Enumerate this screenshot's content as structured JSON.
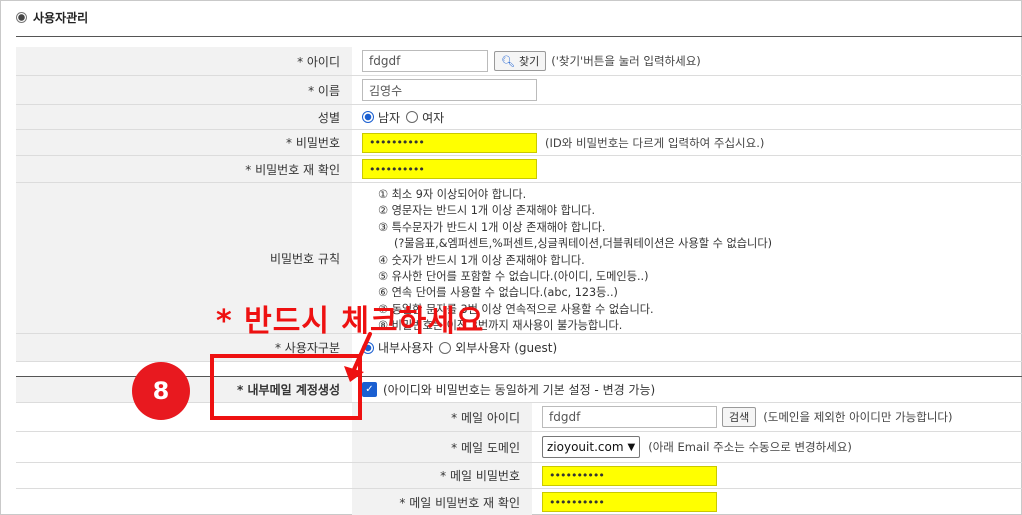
{
  "section_title": "사용자관리",
  "form": {
    "id": {
      "label": "* 아이디",
      "value": "fdgdf",
      "search_label": "찾기",
      "hint": "('찾기'버튼을 눌러 입력하세요)"
    },
    "name": {
      "label": "* 이름",
      "value": "김영수"
    },
    "gender": {
      "label": "성별",
      "option_male": "남자",
      "option_female": "여자",
      "selected": "남자"
    },
    "password": {
      "label": "* 비밀번호",
      "value": "••••••••••",
      "hint": "(ID와 비밀번호는 다르게 입력하여 주십시요.)"
    },
    "password_confirm": {
      "label": "* 비밀번호 재 확인",
      "value": "••••••••••"
    },
    "password_rules": {
      "label": "비밀번호 규칙",
      "lines": [
        "① 최소 9자 이상되어야 합니다.",
        "② 영문자는 반드시 1개 이상 존재해야 합니다.",
        "③ 특수문자가 반드시 1개 이상 존재해야 합니다.",
        "(?물음표,&엠퍼센트,%퍼센트,싱글쿼테이션,더블쿼테이션은 사용할 수 없습니다)",
        "④ 숫자가 반드시 1개 이상 존재해야 합니다.",
        "⑤ 유사한 단어를 포함할 수 없습니다.(아이디, 도메인등..)",
        "⑥ 연속 단어를 사용할 수 없습니다.(abc, 123등..)",
        "⑦ 동일한 문자를 3번 이상 연속적으로 사용할 수 없습니다.",
        "⑧ 비밀번호는 이전 3번까지 재사용이 불가능합니다."
      ]
    },
    "user_type": {
      "label": "* 사용자구분",
      "option_internal": "내부사용자",
      "option_external": "외부사용자 (guest)",
      "selected": "내부사용자"
    },
    "internal_mail": {
      "label": "* 내부메일 계정생성",
      "checked": true,
      "hint": "(아이디와 비밀번호는 동일하게 기본 설정 - 변경 가능)"
    },
    "mail_id": {
      "label": "* 메일 아이디",
      "value": "fdgdf",
      "search_label": "검색",
      "hint": "(도메인을 제외한 아이디만 가능합니다)"
    },
    "mail_domain": {
      "label": "* 메일 도메인",
      "value": "zioyouit.com",
      "hint": "(아래 Email 주소는 수동으로 변경하세요)"
    },
    "mail_password": {
      "label": "* 메일 비밀번호",
      "value": "••••••••••"
    },
    "mail_password_confirm": {
      "label": "* 메일 비밀번호 재 확인",
      "value": "••••••••••"
    }
  },
  "annotation": {
    "text": "* 반드시 체크하세요",
    "badge": "8",
    "color": "#ee1111"
  }
}
